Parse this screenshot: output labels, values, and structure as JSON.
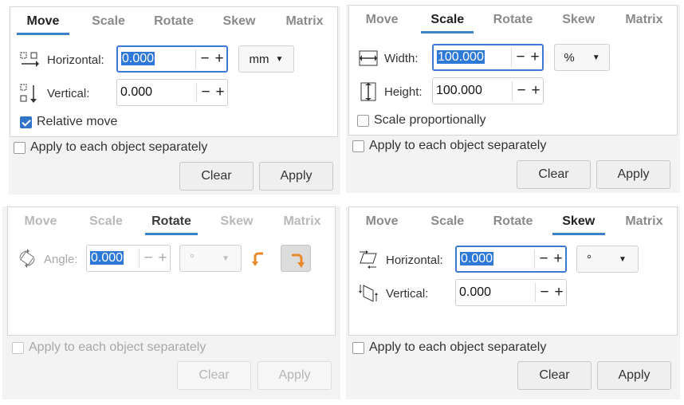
{
  "tabs": [
    "Move",
    "Scale",
    "Rotate",
    "Skew",
    "Matrix"
  ],
  "common": {
    "apply_each": "Apply to each object separately",
    "clear": "Clear",
    "apply": "Apply",
    "minus": "−",
    "plus": "+"
  },
  "move": {
    "active_tab": "Move",
    "horizontal_label": "Horizontal:",
    "horizontal_value": "0.000",
    "vertical_label": "Vertical:",
    "vertical_value": "0.000",
    "unit": "mm",
    "relative_move": "Relative move",
    "relative_checked": true
  },
  "scale": {
    "active_tab": "Scale",
    "width_label": "Width:",
    "width_value": "100.000",
    "height_label": "Height:",
    "height_value": "100.000",
    "unit": "%",
    "proportional": "Scale proportionally"
  },
  "rotate": {
    "active_tab": "Rotate",
    "angle_label": "Angle:",
    "angle_value": "0.000",
    "unit": "°"
  },
  "skew": {
    "active_tab": "Skew",
    "horizontal_label": "Horizontal:",
    "horizontal_value": "0.000",
    "vertical_label": "Vertical:",
    "vertical_value": "0.000",
    "unit": "°"
  },
  "colors": {
    "accent": "#3d82c7",
    "rotate_icon": "#e8892b"
  }
}
